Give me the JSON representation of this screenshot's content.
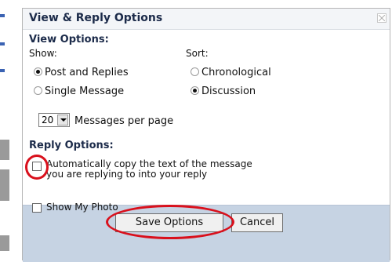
{
  "dialog": {
    "title": "View & Reply Options",
    "close_icon": "close-icon"
  },
  "view_options": {
    "heading": "View Options:",
    "show_label": "Show:",
    "sort_label": "Sort:",
    "show_options": [
      {
        "label": "Post and Replies",
        "selected": true
      },
      {
        "label": "Single Message",
        "selected": false
      }
    ],
    "sort_options": [
      {
        "label": "Chronological",
        "selected": false
      },
      {
        "label": "Discussion",
        "selected": true
      }
    ],
    "messages_per_page": {
      "value": "20",
      "label": "Messages per page"
    }
  },
  "reply_options": {
    "heading": "Reply Options:",
    "auto_copy_line1": "Automatically copy the text of the message",
    "auto_copy_line2": "you are replying to into your reply",
    "auto_copy_checked": false,
    "show_photo_label": "Show My Photo",
    "show_photo_checked": false
  },
  "footer": {
    "save_label": "Save Options",
    "cancel_label": "Cancel"
  },
  "colors": {
    "footer_bg": "#c6d3e3",
    "annotation_red": "#d9101c",
    "heading": "#1c2b4a"
  }
}
